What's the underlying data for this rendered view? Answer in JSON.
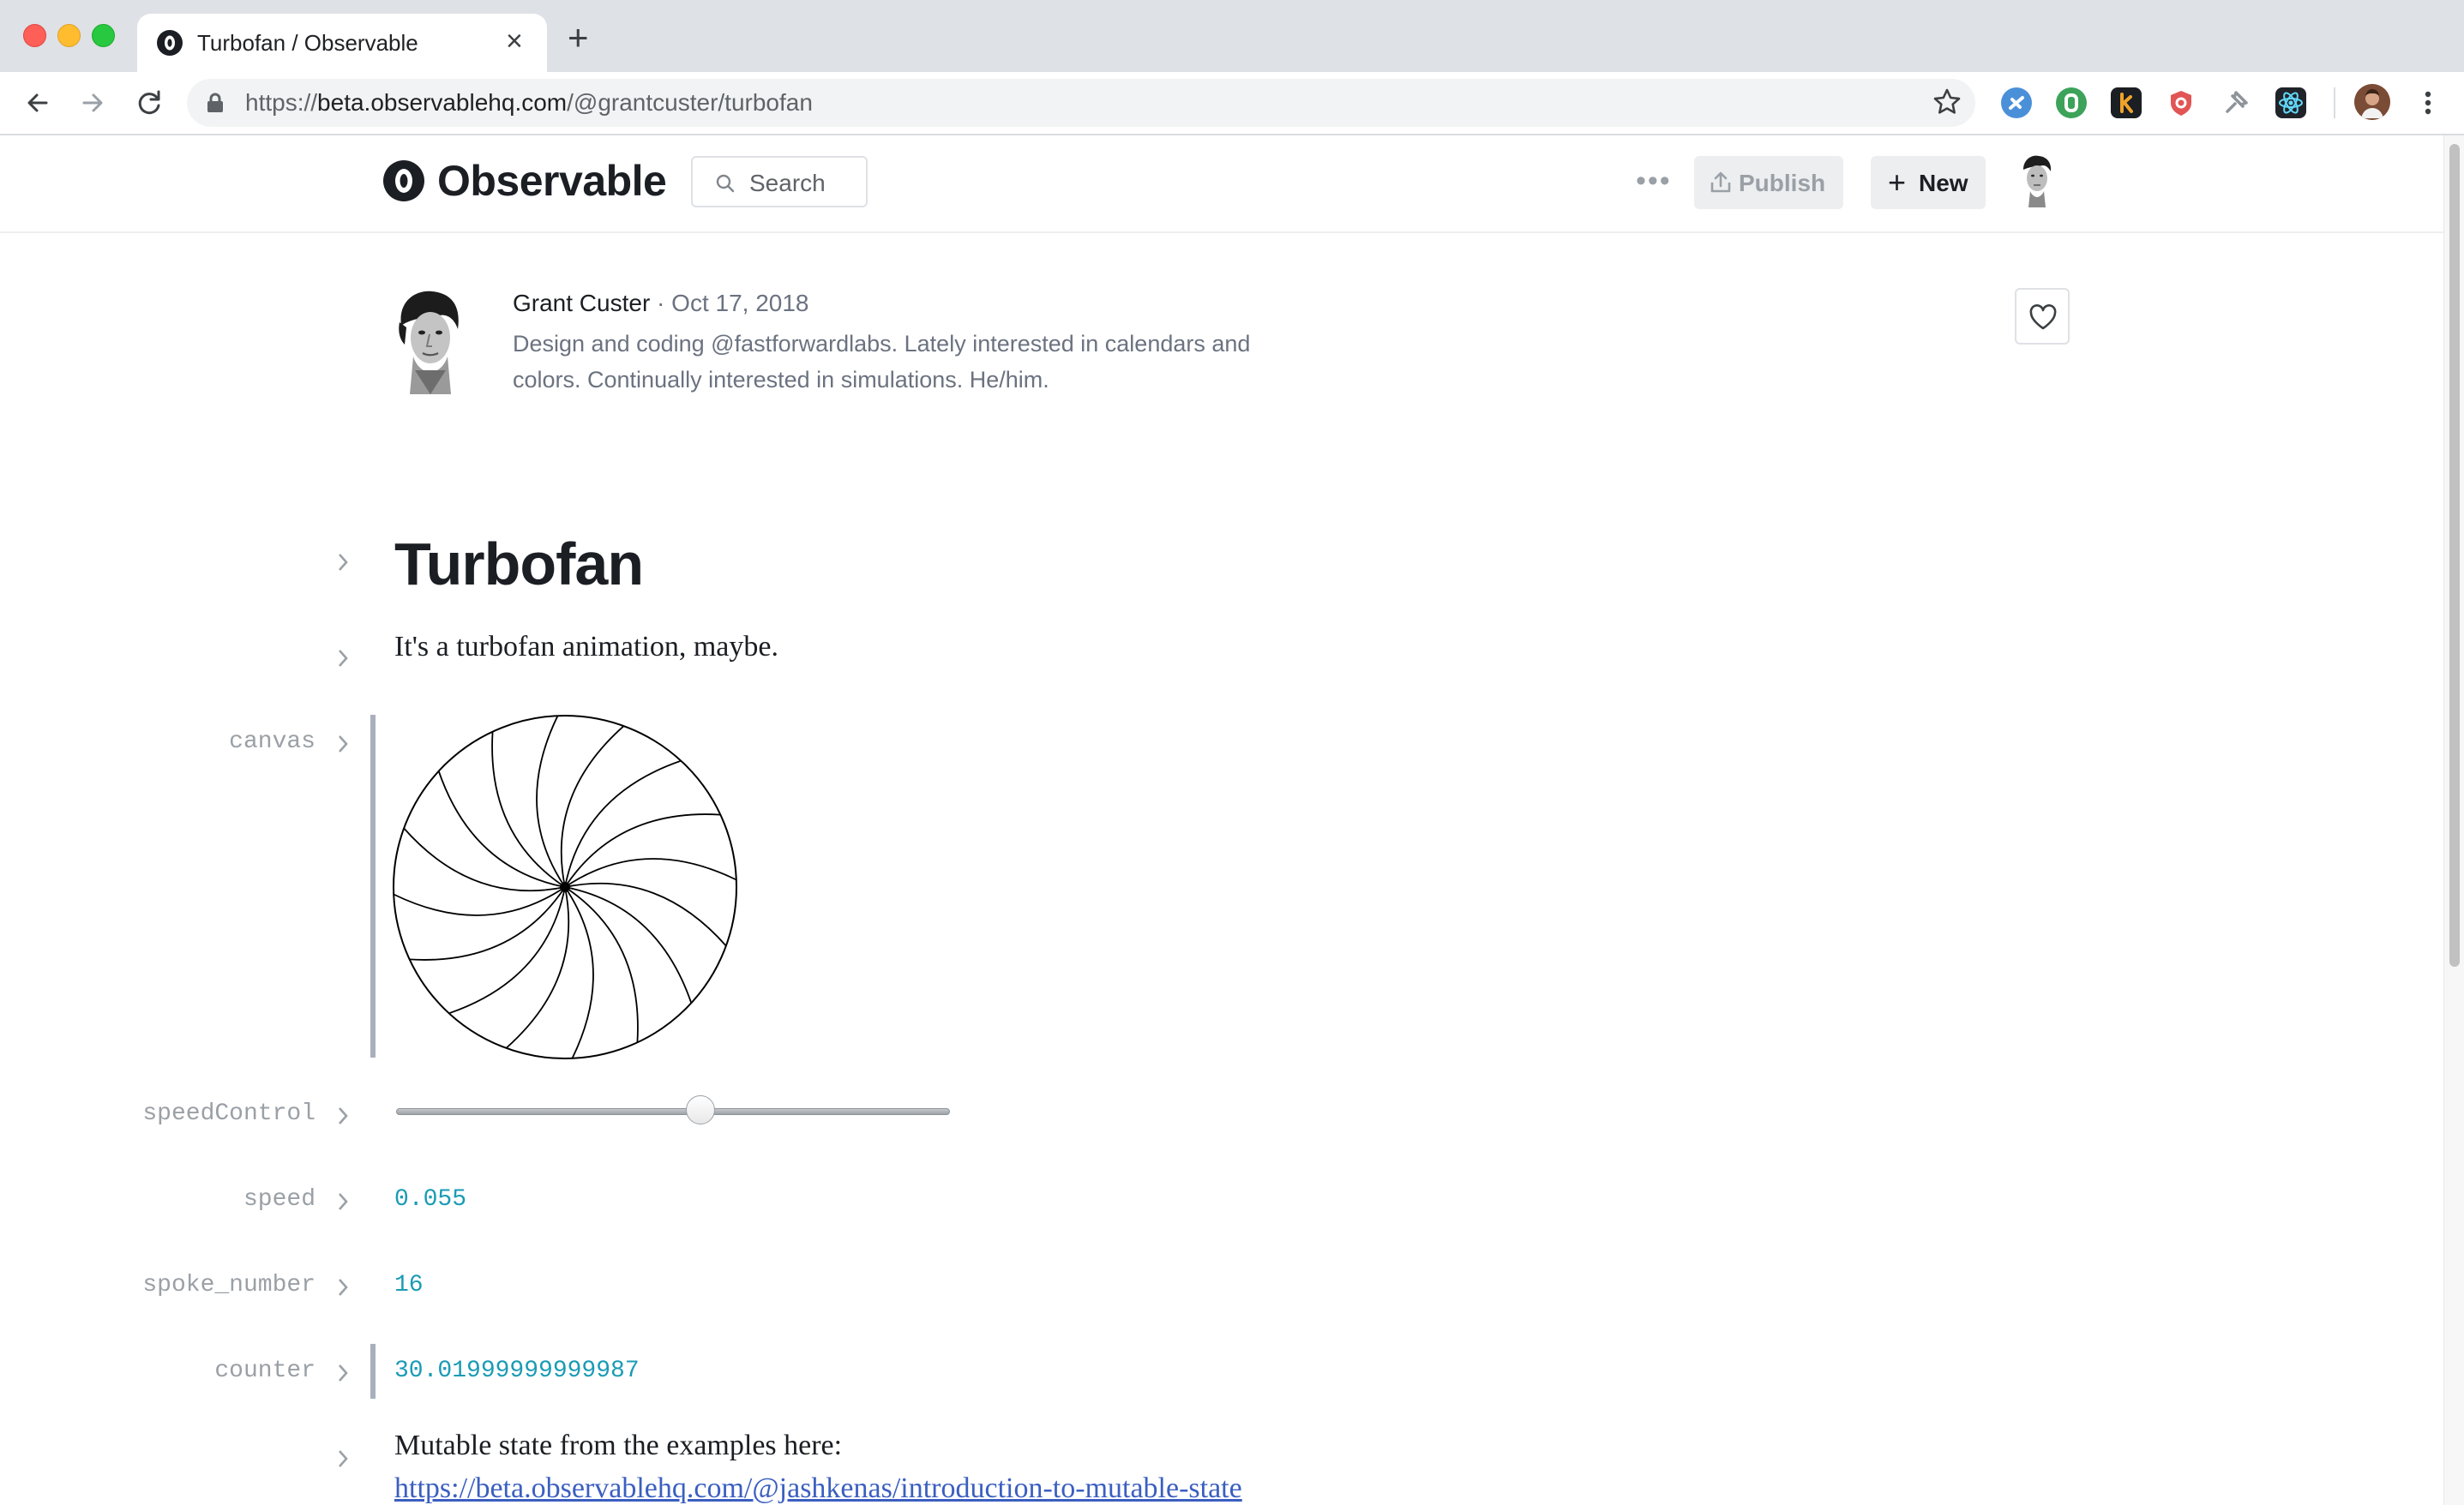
{
  "browser": {
    "tab_title": "Turbofan / Observable",
    "url_prefix": "https://",
    "url_host": "beta.observablehq.com",
    "url_path": "/@grantcuster/turbofan",
    "extensions": [
      {
        "name": "feedly-icon",
        "color": "#2bb24c"
      },
      {
        "name": "dashlane-icon",
        "color": "#3da35a"
      },
      {
        "name": "kindle-icon",
        "color": "#f0a32a"
      },
      {
        "name": "shield-icon",
        "color": "#e25555"
      },
      {
        "name": "pin-icon",
        "color": "#8e949a"
      },
      {
        "name": "react-devtools-icon",
        "color": "#61dafb"
      }
    ]
  },
  "header": {
    "brand": "Observable",
    "search_placeholder": "Search",
    "publish_label": "Publish",
    "new_label": "New"
  },
  "author": {
    "name": "Grant Custer",
    "separator": " · ",
    "date": "Oct 17, 2018",
    "bio": "Design and coding @fastforwardlabs. Lately interested in calendars and colors. Continually interested in simulations. He/him."
  },
  "notebook": {
    "title": "Turbofan",
    "intro": "It's a turbofan animation, maybe.",
    "cells": {
      "canvas_name": "canvas",
      "speed_control_name": "speedControl",
      "speed_name": "speed",
      "speed_value": "0.055",
      "spoke_number_name": "spoke_number",
      "spoke_number_value": "16",
      "counter_name": "counter",
      "counter_value": "30.01999999999987"
    },
    "slider_fraction": 0.55,
    "spoke_count": 16,
    "mutable_text": "Mutable state from the examples here:",
    "mutable_link": "https://beta.observablehq.com/@jashkenas/introduction-to-mutable-state"
  },
  "colors": {
    "accent_value": "#1a9bb5",
    "link": "#3b5fc0"
  }
}
